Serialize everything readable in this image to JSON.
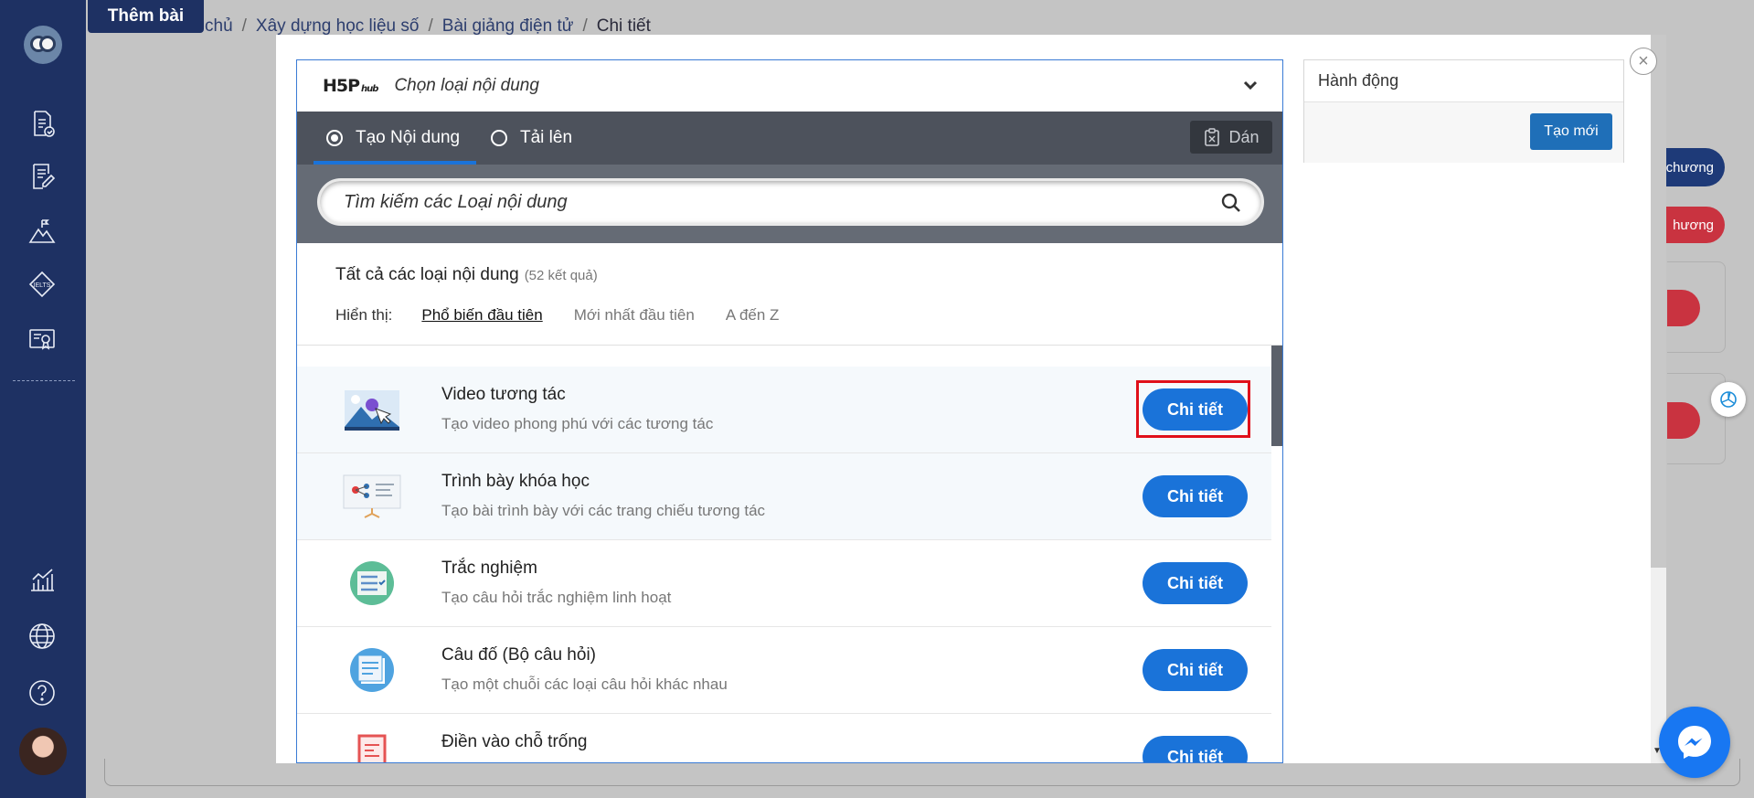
{
  "header": {
    "add_tab_label": "Thêm bài",
    "breadcrumb": [
      "chủ",
      "Xây dựng học liệu số",
      "Bài giảng điện tử",
      "Chi tiết"
    ]
  },
  "background": {
    "blue_pill": "chương",
    "red_pill": "hương"
  },
  "h5p": {
    "logo": "H5P",
    "logo_hub": "hub",
    "title": "Chọn loại nội dung",
    "tabs": [
      {
        "label": "Tạo Nội dung",
        "selected": true
      },
      {
        "label": "Tải lên",
        "selected": false
      }
    ],
    "paste_label": "Dán",
    "search_placeholder": "Tìm kiếm các Loại nội dung",
    "results_title": "Tất cả các loại nội dung",
    "results_count": "(52 kết quả)",
    "sort_label": "Hiển thị:",
    "sort_options": [
      "Phổ biến đầu tiên",
      "Mới nhất đầu tiên",
      "A đến Z"
    ],
    "items": [
      {
        "title": "Video tương tác",
        "desc": "Tạo video phong phú với các tương tác",
        "button": "Chi tiết",
        "icon": "interactive-video-icon"
      },
      {
        "title": "Trình bày khóa học",
        "desc": "Tạo bài trình bày với các trang chiếu tương tác",
        "button": "Chi tiết",
        "icon": "course-presentation-icon"
      },
      {
        "title": "Trắc nghiệm",
        "desc": "Tạo câu hỏi trắc nghiệm linh hoạt",
        "button": "Chi tiết",
        "icon": "multiple-choice-icon"
      },
      {
        "title": "Câu đố (Bộ câu hỏi)",
        "desc": "Tạo một chuỗi các loại câu hỏi khác nhau",
        "button": "Chi tiết",
        "icon": "question-set-icon"
      },
      {
        "title": "Điền vào chỗ trống",
        "desc": "",
        "button": "Chi tiết",
        "icon": "fill-blanks-icon"
      }
    ]
  },
  "actions": {
    "title": "Hành động",
    "create_label": "Tạo mới"
  },
  "colors": {
    "sidebar": "#1e3163",
    "primary": "#1a73d9",
    "highlight": "#e0101a"
  }
}
